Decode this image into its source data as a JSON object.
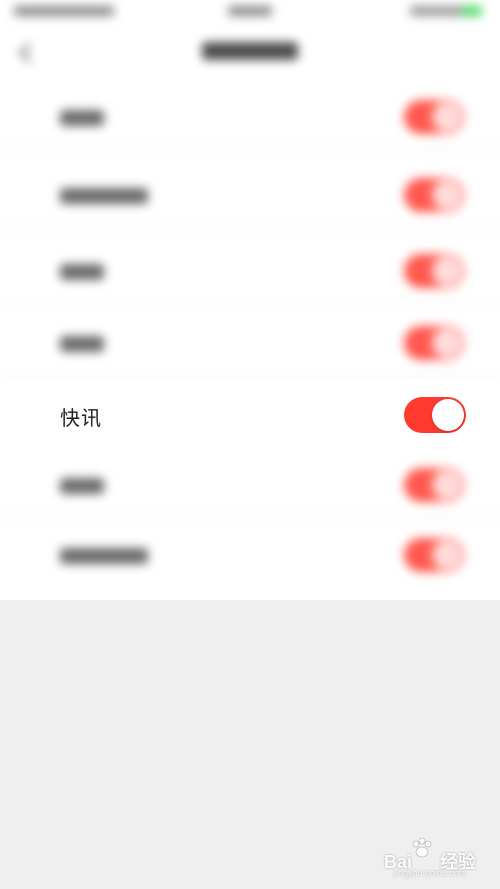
{
  "settings_list": {
    "focused_item": {
      "label": "快讯",
      "toggle_on": true
    }
  },
  "colors": {
    "toggle_on": "#ff3b30",
    "background": "#efefef",
    "list_background": "#ffffff"
  },
  "watermark": {
    "text": "Bai",
    "suffix": "经验",
    "sub": "jingyan.baidu.com"
  }
}
